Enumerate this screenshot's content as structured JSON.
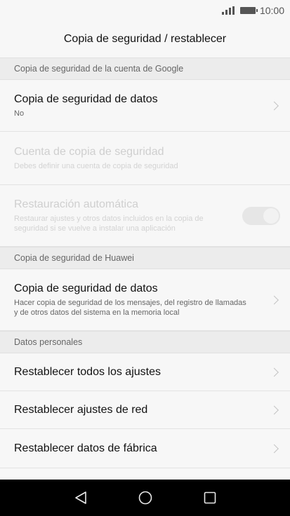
{
  "status_bar": {
    "time": "10:00"
  },
  "header": {
    "title": "Copia de seguridad / restablecer"
  },
  "sections": {
    "google": {
      "header": "Copia de seguridad de la cuenta de Google",
      "backup_data": {
        "label": "Copia de seguridad de datos",
        "value": "No"
      },
      "backup_account": {
        "label": "Cuenta de copia de seguridad",
        "subtitle": "Debes definir una cuenta de copia de seguridad"
      },
      "auto_restore": {
        "label": "Restauración automática",
        "subtitle": "Restaurar ajustes y otros datos incluidos en la copia de seguridad si se vuelve a instalar una aplicación"
      }
    },
    "huawei": {
      "header": "Copia de seguridad de Huawei",
      "backup_data": {
        "label": "Copia de seguridad de datos",
        "subtitle": "Hacer copia de seguridad de los mensajes, del registro de llamadas y de otros datos del sistema en la memoria local"
      }
    },
    "personal": {
      "header": "Datos personales",
      "items": [
        {
          "label": "Restablecer todos los ajustes"
        },
        {
          "label": "Restablecer ajustes de red"
        },
        {
          "label": "Restablecer datos de fábrica"
        }
      ]
    }
  },
  "icons": {
    "signal": "signal-icon",
    "battery": "battery-icon",
    "chevron": "chevron-right-icon",
    "back": "back-icon",
    "home": "home-icon",
    "recents": "recents-icon"
  }
}
